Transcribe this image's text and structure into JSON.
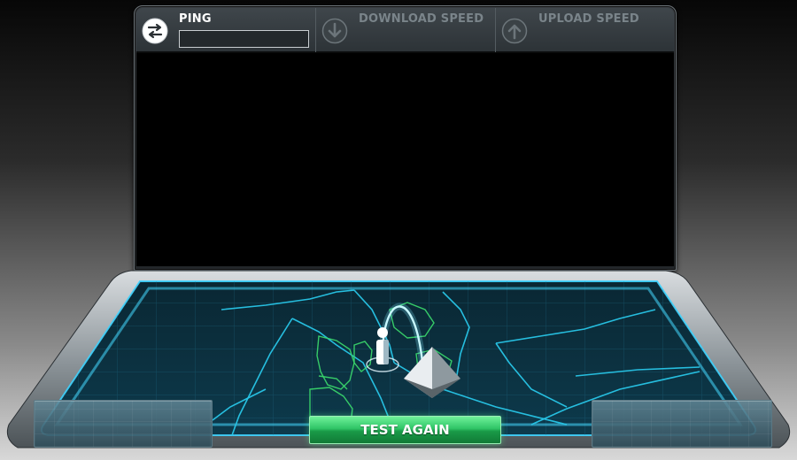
{
  "metrics": {
    "ping": {
      "label": "PING",
      "value": "",
      "icon": "ping-arrows-icon"
    },
    "download": {
      "label": "DOWNLOAD SPEED",
      "icon": "download-arrow-icon"
    },
    "upload": {
      "label": "UPLOAD SPEED",
      "icon": "upload-arrow-icon"
    }
  },
  "actions": {
    "test_again_label": "TEST AGAIN"
  },
  "colors": {
    "accent_green": "#2fc466",
    "map_glow": "#3fd4ff",
    "border_lines": "#2a8fb8",
    "active_label": "#ffffff",
    "inactive_label": "#7a848a"
  }
}
